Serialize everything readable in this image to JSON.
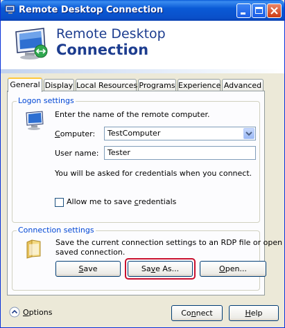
{
  "window": {
    "title": "Remote Desktop Connection"
  },
  "banner": {
    "line1": "Remote Desktop",
    "line2": "Connection"
  },
  "tabs": [
    {
      "label": "General",
      "active": true
    },
    {
      "label": "Display"
    },
    {
      "label": "Local Resources"
    },
    {
      "label": "Programs"
    },
    {
      "label": "Experience"
    },
    {
      "label": "Advanced"
    }
  ],
  "logon": {
    "group_title": "Logon settings",
    "instruction": "Enter the name of the remote computer.",
    "computer_label_pre": "C",
    "computer_label_post": "omputer:",
    "computer_value": "TestComputer",
    "username_label": "User name:",
    "username_value": "Tester",
    "credentials_note": "You will be asked for credentials when you connect.",
    "allow_save_pre": "Allow me to save ",
    "allow_save_u": "c",
    "allow_save_post": "redentials",
    "allow_save_checked": false
  },
  "connection": {
    "group_title": "Connection settings",
    "description_line1": "Save the current connection settings to an RDP file or open a",
    "description_line2": "saved connection.",
    "save_u": "S",
    "save_rest": "ave",
    "saveas_pre": "Sa",
    "saveas_u": "v",
    "saveas_post": "e As...",
    "open_u": "O",
    "open_rest": "pen..."
  },
  "footer": {
    "options_u": "O",
    "options_rest": "ptions",
    "connect_pre": "Co",
    "connect_u": "n",
    "connect_post": "nect",
    "help_u": "H",
    "help_rest": "elp"
  },
  "colors": {
    "accent": "#0046d5",
    "highlight": "#c8102e",
    "titlebar": "#0a5ad6"
  }
}
